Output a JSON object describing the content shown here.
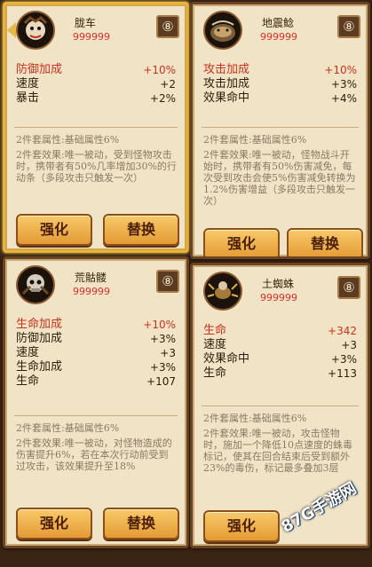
{
  "cards": [
    {
      "name": "胧车",
      "stars": "999999",
      "slot_glyph": "⑧",
      "stats": [
        {
          "label": "防御加成",
          "value": "+10%",
          "main": true
        },
        {
          "label": "速度",
          "value": "+2",
          "main": false
        },
        {
          "label": "暴击",
          "value": "+2%",
          "main": false
        }
      ],
      "set2": "2件套属性:基础属性6%",
      "set4": "2件套效果:唯一被动，受到怪物攻击时，携带者有50%几率增加30%的行动条（多段攻击只触发一次）",
      "btn_enhance": "强化",
      "btn_replace": "替换"
    },
    {
      "name": "地震鲶",
      "stars": "999999",
      "slot_glyph": "⑧",
      "stats": [
        {
          "label": "攻击加成",
          "value": "+10%",
          "main": true
        },
        {
          "label": "攻击加成",
          "value": "+3%",
          "main": false
        },
        {
          "label": "效果命中",
          "value": "+4%",
          "main": false
        }
      ],
      "set2": "2件套属性:基础属性6%",
      "set4": "2件套效果:唯一被动，怪物战斗开始时，携带者有50%伤害减免，每次受到攻击会使5%伤害减免转换为1.2%伤害增益（多段攻击只触发一次）",
      "btn_enhance": "强化",
      "btn_replace": "替换"
    },
    {
      "name": "荒骷髅",
      "stars": "999999",
      "slot_glyph": "⑧",
      "stats": [
        {
          "label": "生命加成",
          "value": "+10%",
          "main": true
        },
        {
          "label": "防御加成",
          "value": "+3%",
          "main": false
        },
        {
          "label": "速度",
          "value": "+3",
          "main": false
        },
        {
          "label": "生命加成",
          "value": "+3%",
          "main": false
        },
        {
          "label": "生命",
          "value": "+107",
          "main": false
        }
      ],
      "set2": "2件套属性:基础属性6%",
      "set4": "2件套效果:唯一被动，对怪物造成的伤害提升6%，若在本次行动前受到过攻击，该效果提升至18%",
      "btn_enhance": "强化",
      "btn_replace": "替换"
    },
    {
      "name": "土蜘蛛",
      "stars": "999999",
      "slot_glyph": "⑧",
      "stats": [
        {
          "label": "生命",
          "value": "+342",
          "main": true
        },
        {
          "label": "速度",
          "value": "+3",
          "main": false
        },
        {
          "label": "效果命中",
          "value": "+3%",
          "main": false
        },
        {
          "label": "生命",
          "value": "+113",
          "main": false
        }
      ],
      "set2": "2件套属性:基础属性6%",
      "set4": "2件套效果:唯一被动，攻击怪物时，施加一个降低10点速度的蛛毒标记，使其在回合结束后受到额外23%的毒伤，标记最多叠加3层",
      "btn_enhance": "强化",
      "btn_replace": ""
    }
  ],
  "watermark": "87G手游网"
}
